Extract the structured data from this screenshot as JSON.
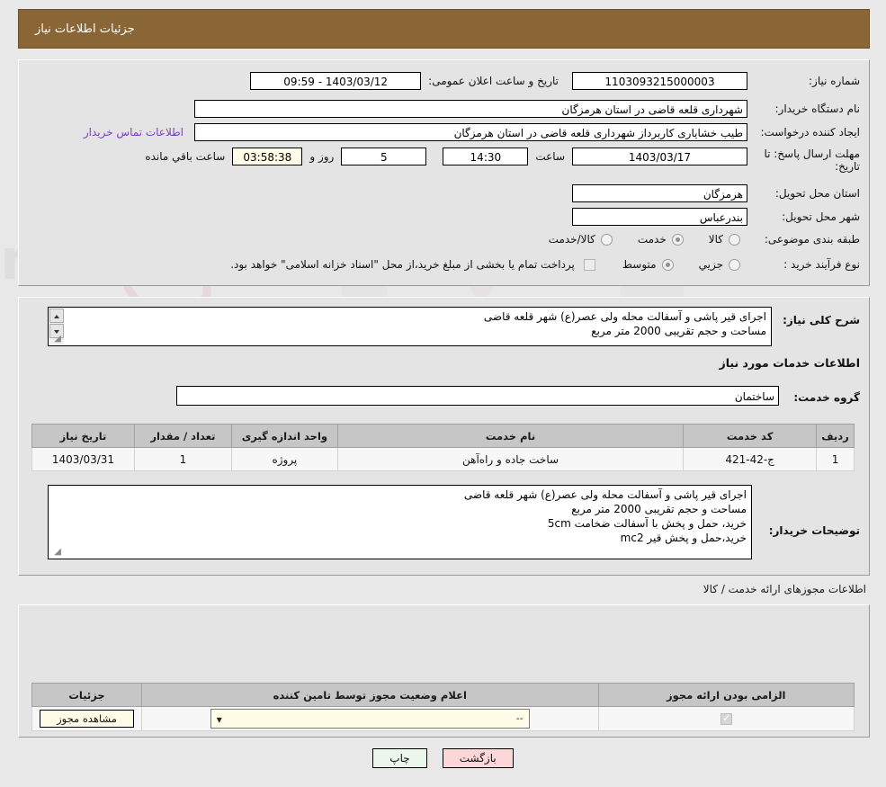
{
  "header": {
    "title": "جزئیات اطلاعات نیاز"
  },
  "main": {
    "need_number_label": "شماره نیاز:",
    "need_number_value": "1103093215000003",
    "announce_label": "تاریخ و ساعت اعلان عمومی:",
    "announce_value": "1403/03/12 - 09:59",
    "buyer_org_label": "نام دستگاه خریدار:",
    "buyer_org_value": "شهرداری قلعه قاضی در استان هرمزگان",
    "creator_label": "ایجاد کننده درخواست:",
    "creator_value": "طیب خشایاری کاربرداز شهرداری قلعه قاضی در استان هرمزگان",
    "contact_link": "اطلاعات تماس خریدار",
    "deadline_label_1": "مهلت ارسال پاسخ: تا",
    "deadline_label_2": "تاریخ:",
    "deadline_date": "1403/03/17",
    "hour_label": "ساعت",
    "deadline_time": "14:30",
    "days_value": "5",
    "days_label": "روز و",
    "countdown_value": "03:58:38",
    "countdown_label": "ساعت باقي مانده",
    "province_label": "استان محل تحویل:",
    "province_value": "هرمزگان",
    "city_label": "شهر محل تحویل:",
    "city_value": "بندرعباس",
    "category_label": "طبقه بندی موضوعی:",
    "category_options": [
      {
        "label": "کالا",
        "selected": false
      },
      {
        "label": "خدمت",
        "selected": true
      },
      {
        "label": "کالا/خدمت",
        "selected": false
      }
    ],
    "process_label": "نوع فرآیند خرید :",
    "process_options": [
      {
        "label": "جزيي",
        "selected": false
      },
      {
        "label": "متوسط",
        "selected": true
      }
    ],
    "treasury_checkbox": false,
    "treasury_note": "پرداخت تمام یا بخشی از مبلغ خرید،از محل \"اسناد خزانه اسلامی\" خواهد بود."
  },
  "description": {
    "general_label": "شرح کلی نیاز:",
    "general_lines": [
      "اجرای قیر پاشی و آسفالت محله ولی عصر(ع) شهر قلعه قاضی",
      "مساحت و حجم تقریبی 2000 متر مربع"
    ],
    "services_heading": "اطلاعات خدمات مورد نیاز",
    "service_group_label": "گروه خدمت:",
    "service_group_value": "ساختمان",
    "table": {
      "headers": [
        "ردیف",
        "کد خدمت",
        "نام خدمت",
        "واحد اندازه گیری",
        "تعداد / مقدار",
        "تاریخ نیاز"
      ],
      "rows": [
        [
          "1",
          "ج-42-421",
          "ساخت جاده و راه‌آهن",
          "پروژه",
          "1",
          "1403/03/31"
        ]
      ]
    },
    "buyer_notes_label": "توضیحات خریدار:",
    "buyer_notes_lines": [
      "اجرای قیر پاشی و آسفالت محله ولی عصر(ع) شهر قلعه قاضی",
      "مساحت و حجم تقریبی 2000 متر مربع",
      "خرید، حمل و پخش با آسفالت ضخامت 5cm",
      "خرید،حمل و پخش قیر mc2"
    ]
  },
  "permits": {
    "section_title": "اطلاعات مجوزهای ارائه خدمت / کالا",
    "headers": [
      "الزامی بودن ارائه مجوز",
      "اعلام وضعیت مجوز توسط تامین کننده",
      "جزئیات"
    ],
    "row": {
      "required_checked": true,
      "status_value": "--",
      "details_button": "مشاهده مجوز"
    }
  },
  "footer": {
    "print_button": "چاپ",
    "back_button": "بازگشت"
  },
  "colors": {
    "header_bar": "#8a6637",
    "link": "#7b3fbf",
    "page_bg": "#e8e8e8",
    "panel_bg": "#e4e4e4",
    "table_header": "#c6c6c6",
    "print_button": "#eaf7ea",
    "back_button": "#fdd7d7",
    "input_yellow": "#fffde8"
  }
}
